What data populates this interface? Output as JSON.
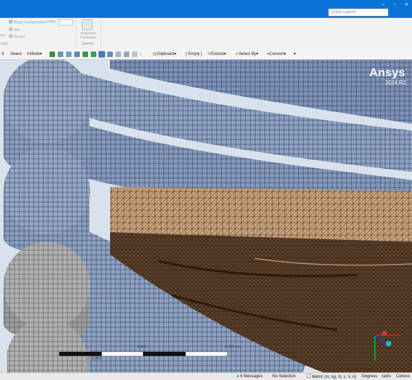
{
  "window": {
    "quick_launch_placeholder": "Quick Launch",
    "minimize": "−",
    "restore": "▫",
    "close": "×"
  },
  "ribbon": {
    "body_config": "Body Configuration",
    "deltas_label": "Delta",
    "deltas_value": "0",
    "set": "Set",
    "revert": "Revert",
    "left_partial_1": "ent",
    "left_partial_2": "odify",
    "import_thickness": "Imported Thickness",
    "sheets": "Sheets"
  },
  "toolbar": {
    "select": "Select",
    "mode": "Mode",
    "clipboard": "Clipboard",
    "empty": "[ Empty ]",
    "extend": "Extend",
    "select_by": "Select By",
    "convert": "Convert"
  },
  "viewport": {
    "logo": "Ansys",
    "version": "2024 R2",
    "scale_mid": "0.000",
    "scale_right": "0.005 (m)",
    "scale_bottom": "0.003"
  },
  "status": {
    "messages": "6 Messages",
    "selection": "No Selection",
    "units": "Metric (m, kg, N, s, V, A)",
    "angle": "Degrees",
    "angular_velocity": "rad/s",
    "temperature": "Celsius"
  },
  "colors": {
    "title_blue": "#0a74d6",
    "coil_steel": "#8a9ec0",
    "mesh_tan": "#c8a27c",
    "mesh_dark": "#5a3f2b"
  }
}
